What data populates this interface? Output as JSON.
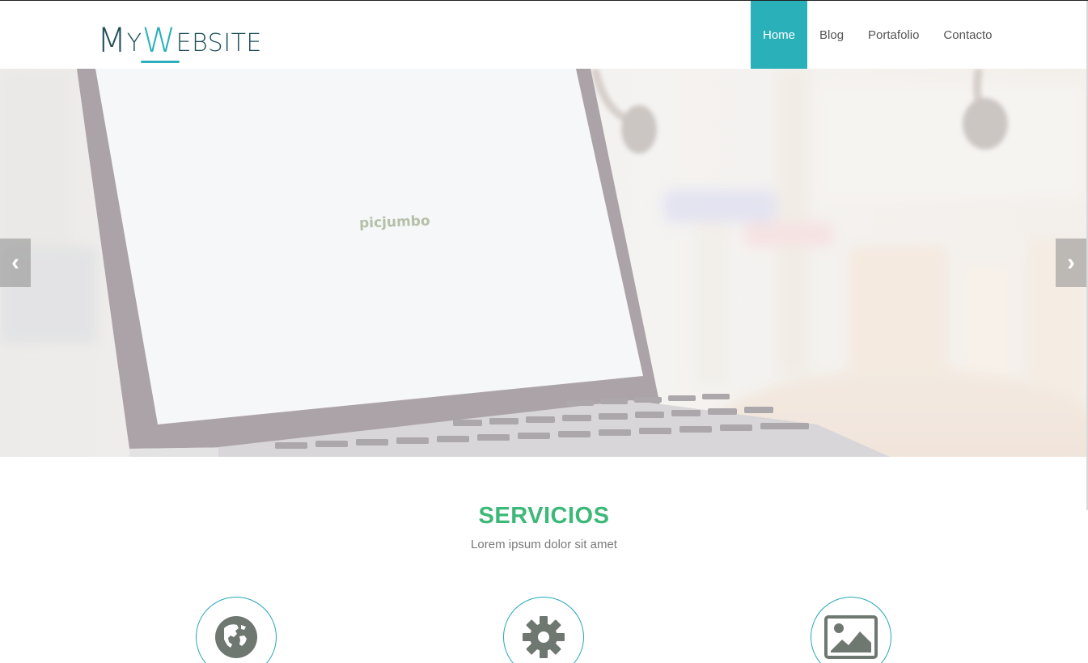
{
  "brand": {
    "logo_M": "M",
    "logo_y": "Y",
    "logo_W": "W",
    "logo_rest": "EBSITE"
  },
  "nav": {
    "items": [
      {
        "label": "Home",
        "active": true
      },
      {
        "label": "Blog",
        "active": false
      },
      {
        "label": "Portafolio",
        "active": false
      },
      {
        "label": "Contacto",
        "active": false
      }
    ]
  },
  "hero": {
    "screen_text": "picjumbo",
    "prev_label": "‹",
    "next_label": "›"
  },
  "services": {
    "title": "SERVICIOS",
    "subtitle": "Lorem ipsum dolor sit amet",
    "items": [
      {
        "icon": "globe-icon"
      },
      {
        "icon": "gear-icon"
      },
      {
        "icon": "image-icon"
      }
    ]
  },
  "colors": {
    "accent": "#2ab0b9",
    "services_title": "#3cb878",
    "icon_gray": "#6f7771"
  }
}
